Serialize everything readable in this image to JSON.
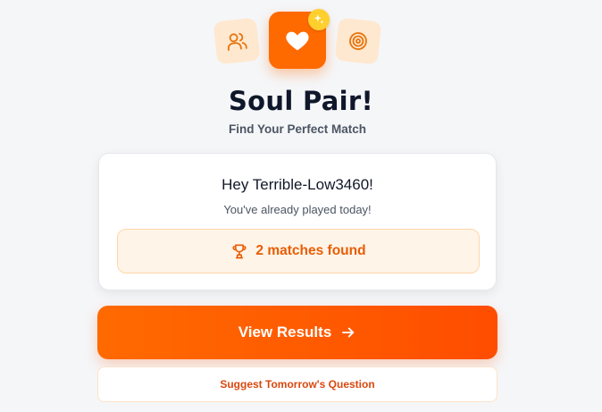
{
  "app": {
    "title": "Soul Pair!",
    "subtitle": "Find Your Perfect Match"
  },
  "icons": {
    "left": "users-icon",
    "center": "heart-icon",
    "badge": "sparkle-icon",
    "right": "target-icon",
    "matches": "trophy-icon",
    "arrow": "arrow-right-icon"
  },
  "status_card": {
    "greeting": "Hey Terrible-Low3460!",
    "message": "You've already played today!",
    "matches_label": "2 matches found"
  },
  "actions": {
    "view_results_label": "View Results",
    "suggest_label": "Suggest Tomorrow's Question"
  },
  "colors": {
    "accent": "#ff6a00",
    "accent_text": "#e85d04",
    "tile_bg": "#ffe8d0",
    "badge": "#ffcf2e"
  }
}
